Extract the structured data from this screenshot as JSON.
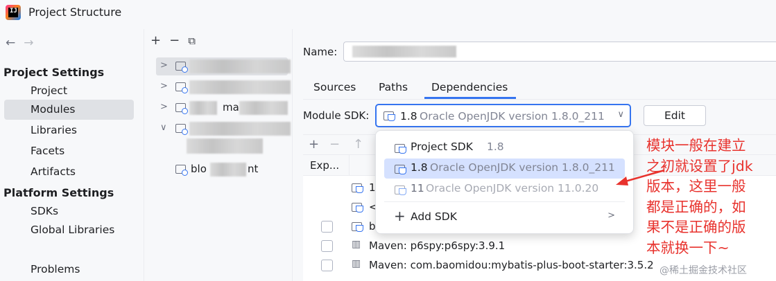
{
  "window": {
    "title": "Project Structure"
  },
  "nav": {
    "back_icon": "arrow-left-icon",
    "forward_icon": "arrow-right-icon",
    "project_settings_header": "Project Settings",
    "project_settings_items": [
      "Project",
      "Modules",
      "Libraries",
      "Facets",
      "Artifacts"
    ],
    "selected_item": "Modules",
    "platform_settings_header": "Platform Settings",
    "platform_settings_items": [
      "SDKs",
      "Global Libraries"
    ],
    "problems": "Problems"
  },
  "tree": {
    "toolbar_icons": [
      "plus-icon",
      "minus-icon",
      "copy-icon"
    ],
    "partial_labels": [
      "ma",
      "blo",
      "nt"
    ]
  },
  "main": {
    "name_label": "Name:",
    "tabs": [
      "Sources",
      "Paths",
      "Dependencies"
    ],
    "active_tab": "Dependencies",
    "module_sdk_label": "Module SDK:",
    "sdk_selected_version": "1.8",
    "sdk_selected_desc": "Oracle OpenJDK version 1.8.0_211",
    "edit_button": "Edit",
    "dep_header_export": "Exp...",
    "dep_rows": [
      {
        "label": "1",
        "icon": "jdk-icon",
        "checkbox": false
      },
      {
        "label": "<",
        "icon": "module-source-icon",
        "checkbox": false
      },
      {
        "label": "b",
        "icon": "module-icon",
        "checkbox": true
      },
      {
        "label": "Maven: p6spy:p6spy:3.9.1",
        "icon": "library-icon",
        "checkbox": true
      },
      {
        "label": "Maven: com.baomidou:mybatis-plus-boot-starter:3.5.2",
        "icon": "library-icon",
        "checkbox": true
      }
    ]
  },
  "popup": {
    "options": [
      {
        "version": "Project SDK",
        "desc": "1.8",
        "selected": false
      },
      {
        "version": "1.8",
        "desc": "Oracle OpenJDK version 1.8.0_211",
        "selected": true
      },
      {
        "version": "11",
        "desc": "Oracle OpenJDK version 11.0.20",
        "selected": false,
        "dimmed": true
      }
    ],
    "add_sdk": "Add SDK"
  },
  "annotation": {
    "lines": [
      "模块一般在建立",
      "之初就设置了jdk",
      "版本，这里一般",
      "都是正确的，如",
      "果不是正确的版",
      "本就换一下~"
    ],
    "color": "#e8322d"
  },
  "watermark": "@稀土掘金技术社区",
  "colors": {
    "accent": "#3574f0",
    "selection": "#d5e1ff",
    "nav_selection": "#dfe1e5"
  }
}
